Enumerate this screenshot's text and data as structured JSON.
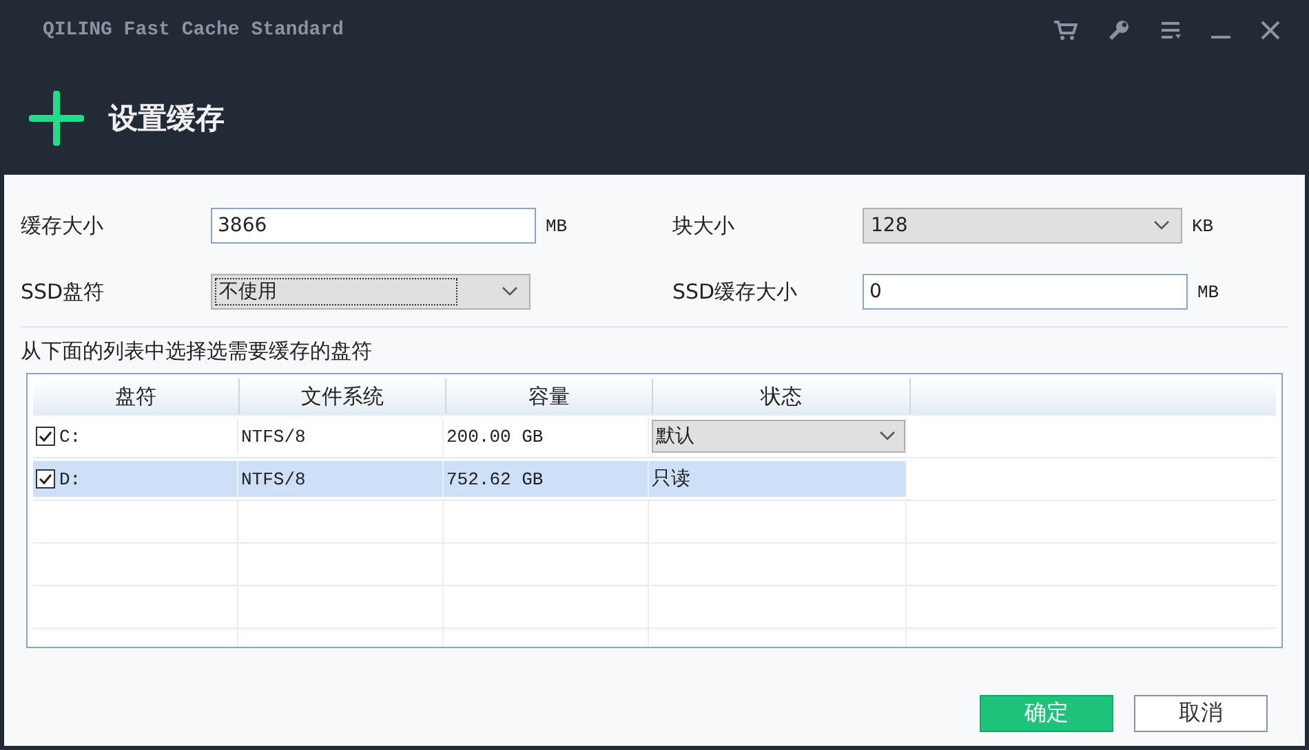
{
  "window": {
    "title": "QILING Fast Cache Standard"
  },
  "header": {
    "title": "设置缓存"
  },
  "settings": [
    {
      "label": "缓存大小",
      "kind": "input",
      "value": "3866",
      "unit": "MB"
    },
    {
      "label": "块大小",
      "kind": "dropdown",
      "value": "128",
      "unit": "KB"
    },
    {
      "label": "SSD盘符",
      "kind": "dropdown",
      "value": "不使用",
      "focused": true
    },
    {
      "label": "SSD缓存大小",
      "kind": "input",
      "value": "0",
      "unit": "MB"
    }
  ],
  "table": {
    "caption": "从下面的列表中选择选需要缓存的盘符",
    "columns": [
      "盘符",
      "文件系统",
      "容量",
      "状态"
    ],
    "rows": [
      {
        "drive": "C:",
        "checked": true,
        "file_system": "NTFS/8",
        "capacity": "200.00 GB",
        "status": "默认",
        "kind": "dropdown",
        "selected": false
      },
      {
        "drive": "D:",
        "checked": true,
        "file_system": "NTFS/8",
        "capacity": "752.62 GB",
        "status": "只读",
        "kind": "text",
        "selected": true
      }
    ]
  },
  "buttons": [
    {
      "label": "确定",
      "kind": "primary"
    },
    {
      "label": "取消",
      "kind": "secondary"
    }
  ]
}
